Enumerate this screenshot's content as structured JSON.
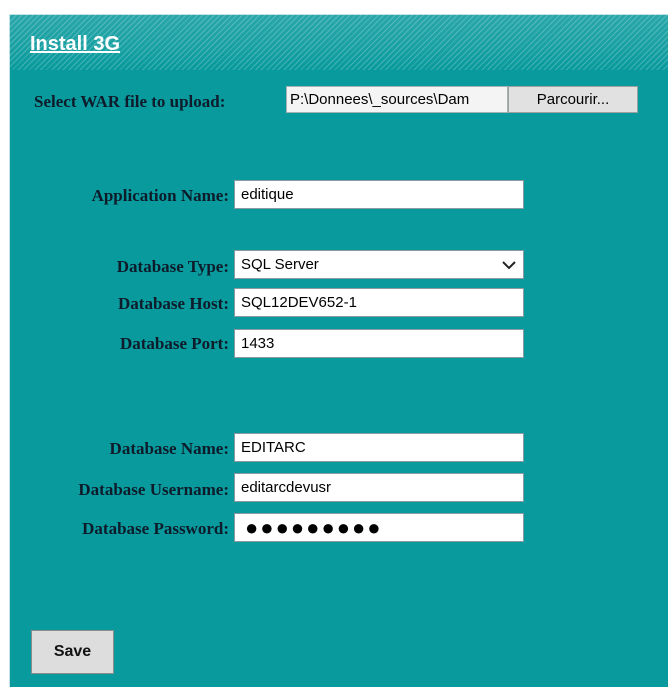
{
  "form": {
    "title": "Install 3G",
    "war_label": "Select WAR file to upload:",
    "war_value": "P:\\Donnees\\_sources\\Dam",
    "browse_label": "Parcourir...",
    "app_name_label": "Application Name:",
    "app_name_value": "editique",
    "db_type_label": "Database Type:",
    "db_type_value": "SQL Server",
    "db_host_label": "Database Host:",
    "db_host_value": "SQL12DEV652-1",
    "db_port_label": "Database Port:",
    "db_port_value": "1433",
    "db_name_label": "Database Name:",
    "db_name_value": "EDITARC",
    "db_user_label": "Database Username:",
    "db_user_value": "editarcdevusr",
    "db_pass_label": "Database Password:",
    "db_pass_value": "●●●●●●●●●",
    "save_label": "Save"
  },
  "colors": {
    "panel_bg": "#089a9c",
    "label_text": "#0d1b2a",
    "title_text": "#ffffff"
  },
  "icons": {
    "select_arrow": "chevron-down-icon"
  }
}
